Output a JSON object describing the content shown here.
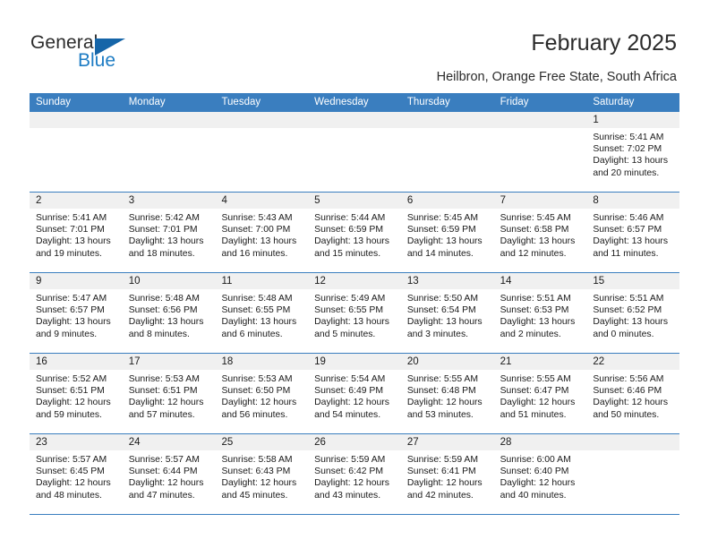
{
  "brand": {
    "word1": "General",
    "word2": "Blue",
    "flag_icon": "blue-triangle-flag-icon",
    "accent_color": "#1d7cc4"
  },
  "header": {
    "title": "February 2025",
    "subtitle": "Heilbron, Orange Free State, South Africa"
  },
  "theme": {
    "header_blue": "#3a7ebf",
    "daynum_band": "#f0f0f0",
    "text": "#1a1a1a"
  },
  "calendar": {
    "weekdays": [
      "Sunday",
      "Monday",
      "Tuesday",
      "Wednesday",
      "Thursday",
      "Friday",
      "Saturday"
    ],
    "weeks": [
      [
        {
          "day": "",
          "sunrise": "",
          "sunset": "",
          "daylight1": "",
          "daylight2": ""
        },
        {
          "day": "",
          "sunrise": "",
          "sunset": "",
          "daylight1": "",
          "daylight2": ""
        },
        {
          "day": "",
          "sunrise": "",
          "sunset": "",
          "daylight1": "",
          "daylight2": ""
        },
        {
          "day": "",
          "sunrise": "",
          "sunset": "",
          "daylight1": "",
          "daylight2": ""
        },
        {
          "day": "",
          "sunrise": "",
          "sunset": "",
          "daylight1": "",
          "daylight2": ""
        },
        {
          "day": "",
          "sunrise": "",
          "sunset": "",
          "daylight1": "",
          "daylight2": ""
        },
        {
          "day": "1",
          "sunrise": "Sunrise: 5:41 AM",
          "sunset": "Sunset: 7:02 PM",
          "daylight1": "Daylight: 13 hours",
          "daylight2": "and 20 minutes."
        }
      ],
      [
        {
          "day": "2",
          "sunrise": "Sunrise: 5:41 AM",
          "sunset": "Sunset: 7:01 PM",
          "daylight1": "Daylight: 13 hours",
          "daylight2": "and 19 minutes."
        },
        {
          "day": "3",
          "sunrise": "Sunrise: 5:42 AM",
          "sunset": "Sunset: 7:01 PM",
          "daylight1": "Daylight: 13 hours",
          "daylight2": "and 18 minutes."
        },
        {
          "day": "4",
          "sunrise": "Sunrise: 5:43 AM",
          "sunset": "Sunset: 7:00 PM",
          "daylight1": "Daylight: 13 hours",
          "daylight2": "and 16 minutes."
        },
        {
          "day": "5",
          "sunrise": "Sunrise: 5:44 AM",
          "sunset": "Sunset: 6:59 PM",
          "daylight1": "Daylight: 13 hours",
          "daylight2": "and 15 minutes."
        },
        {
          "day": "6",
          "sunrise": "Sunrise: 5:45 AM",
          "sunset": "Sunset: 6:59 PM",
          "daylight1": "Daylight: 13 hours",
          "daylight2": "and 14 minutes."
        },
        {
          "day": "7",
          "sunrise": "Sunrise: 5:45 AM",
          "sunset": "Sunset: 6:58 PM",
          "daylight1": "Daylight: 13 hours",
          "daylight2": "and 12 minutes."
        },
        {
          "day": "8",
          "sunrise": "Sunrise: 5:46 AM",
          "sunset": "Sunset: 6:57 PM",
          "daylight1": "Daylight: 13 hours",
          "daylight2": "and 11 minutes."
        }
      ],
      [
        {
          "day": "9",
          "sunrise": "Sunrise: 5:47 AM",
          "sunset": "Sunset: 6:57 PM",
          "daylight1": "Daylight: 13 hours",
          "daylight2": "and 9 minutes."
        },
        {
          "day": "10",
          "sunrise": "Sunrise: 5:48 AM",
          "sunset": "Sunset: 6:56 PM",
          "daylight1": "Daylight: 13 hours",
          "daylight2": "and 8 minutes."
        },
        {
          "day": "11",
          "sunrise": "Sunrise: 5:48 AM",
          "sunset": "Sunset: 6:55 PM",
          "daylight1": "Daylight: 13 hours",
          "daylight2": "and 6 minutes."
        },
        {
          "day": "12",
          "sunrise": "Sunrise: 5:49 AM",
          "sunset": "Sunset: 6:55 PM",
          "daylight1": "Daylight: 13 hours",
          "daylight2": "and 5 minutes."
        },
        {
          "day": "13",
          "sunrise": "Sunrise: 5:50 AM",
          "sunset": "Sunset: 6:54 PM",
          "daylight1": "Daylight: 13 hours",
          "daylight2": "and 3 minutes."
        },
        {
          "day": "14",
          "sunrise": "Sunrise: 5:51 AM",
          "sunset": "Sunset: 6:53 PM",
          "daylight1": "Daylight: 13 hours",
          "daylight2": "and 2 minutes."
        },
        {
          "day": "15",
          "sunrise": "Sunrise: 5:51 AM",
          "sunset": "Sunset: 6:52 PM",
          "daylight1": "Daylight: 13 hours",
          "daylight2": "and 0 minutes."
        }
      ],
      [
        {
          "day": "16",
          "sunrise": "Sunrise: 5:52 AM",
          "sunset": "Sunset: 6:51 PM",
          "daylight1": "Daylight: 12 hours",
          "daylight2": "and 59 minutes."
        },
        {
          "day": "17",
          "sunrise": "Sunrise: 5:53 AM",
          "sunset": "Sunset: 6:51 PM",
          "daylight1": "Daylight: 12 hours",
          "daylight2": "and 57 minutes."
        },
        {
          "day": "18",
          "sunrise": "Sunrise: 5:53 AM",
          "sunset": "Sunset: 6:50 PM",
          "daylight1": "Daylight: 12 hours",
          "daylight2": "and 56 minutes."
        },
        {
          "day": "19",
          "sunrise": "Sunrise: 5:54 AM",
          "sunset": "Sunset: 6:49 PM",
          "daylight1": "Daylight: 12 hours",
          "daylight2": "and 54 minutes."
        },
        {
          "day": "20",
          "sunrise": "Sunrise: 5:55 AM",
          "sunset": "Sunset: 6:48 PM",
          "daylight1": "Daylight: 12 hours",
          "daylight2": "and 53 minutes."
        },
        {
          "day": "21",
          "sunrise": "Sunrise: 5:55 AM",
          "sunset": "Sunset: 6:47 PM",
          "daylight1": "Daylight: 12 hours",
          "daylight2": "and 51 minutes."
        },
        {
          "day": "22",
          "sunrise": "Sunrise: 5:56 AM",
          "sunset": "Sunset: 6:46 PM",
          "daylight1": "Daylight: 12 hours",
          "daylight2": "and 50 minutes."
        }
      ],
      [
        {
          "day": "23",
          "sunrise": "Sunrise: 5:57 AM",
          "sunset": "Sunset: 6:45 PM",
          "daylight1": "Daylight: 12 hours",
          "daylight2": "and 48 minutes."
        },
        {
          "day": "24",
          "sunrise": "Sunrise: 5:57 AM",
          "sunset": "Sunset: 6:44 PM",
          "daylight1": "Daylight: 12 hours",
          "daylight2": "and 47 minutes."
        },
        {
          "day": "25",
          "sunrise": "Sunrise: 5:58 AM",
          "sunset": "Sunset: 6:43 PM",
          "daylight1": "Daylight: 12 hours",
          "daylight2": "and 45 minutes."
        },
        {
          "day": "26",
          "sunrise": "Sunrise: 5:59 AM",
          "sunset": "Sunset: 6:42 PM",
          "daylight1": "Daylight: 12 hours",
          "daylight2": "and 43 minutes."
        },
        {
          "day": "27",
          "sunrise": "Sunrise: 5:59 AM",
          "sunset": "Sunset: 6:41 PM",
          "daylight1": "Daylight: 12 hours",
          "daylight2": "and 42 minutes."
        },
        {
          "day": "28",
          "sunrise": "Sunrise: 6:00 AM",
          "sunset": "Sunset: 6:40 PM",
          "daylight1": "Daylight: 12 hours",
          "daylight2": "and 40 minutes."
        },
        {
          "day": "",
          "sunrise": "",
          "sunset": "",
          "daylight1": "",
          "daylight2": ""
        }
      ]
    ]
  }
}
